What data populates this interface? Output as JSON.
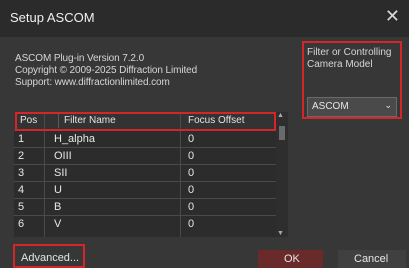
{
  "window": {
    "title": "Setup ASCOM"
  },
  "info": {
    "line1": "ASCOM Plug-in Version 7.2.0",
    "line2": "Copyright © 2009-2025 Diffraction Limited",
    "line3": "Support: www.diffractionlimited.com"
  },
  "filter_model": {
    "label": "Filter or Controlling Camera Model",
    "selected": "ASCOM"
  },
  "table": {
    "headers": [
      "Pos",
      "Filter Name",
      "Focus Offset"
    ],
    "rows": [
      {
        "pos": "1",
        "name": "H_alpha",
        "offset": "0"
      },
      {
        "pos": "2",
        "name": "OIII",
        "offset": "0"
      },
      {
        "pos": "3",
        "name": "SII",
        "offset": "0"
      },
      {
        "pos": "4",
        "name": "U",
        "offset": "0"
      },
      {
        "pos": "5",
        "name": "B",
        "offset": "0"
      },
      {
        "pos": "6",
        "name": "V",
        "offset": "0"
      }
    ]
  },
  "buttons": {
    "advanced": "Advanced...",
    "ok": "OK",
    "cancel": "Cancel"
  },
  "icons": {
    "close": "close-icon",
    "dropdown": "chevron-down-icon"
  },
  "colors": {
    "highlight": "#d4252a",
    "ok_button": "#6a2a2a"
  }
}
